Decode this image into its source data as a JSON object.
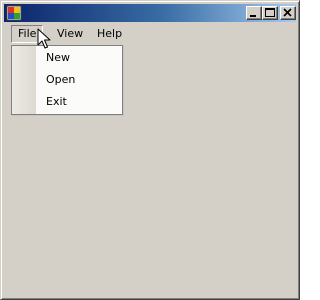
{
  "window": {
    "title": ""
  },
  "titlebar": {
    "icon": "app-icon",
    "controls": [
      "minimize-icon",
      "maximize-icon",
      "close-icon"
    ],
    "gradient_start": "#0a246a",
    "gradient_end": "#a6caf0"
  },
  "menubar": {
    "items": [
      {
        "label": "File"
      },
      {
        "label": "View"
      },
      {
        "label": "Help"
      }
    ]
  },
  "dropdown": {
    "items": [
      {
        "label": "New"
      },
      {
        "label": "Open"
      },
      {
        "label": "Exit"
      }
    ]
  },
  "colors": {
    "window_background": "#d4d0c8",
    "menu_background": "#fbfbf9"
  }
}
